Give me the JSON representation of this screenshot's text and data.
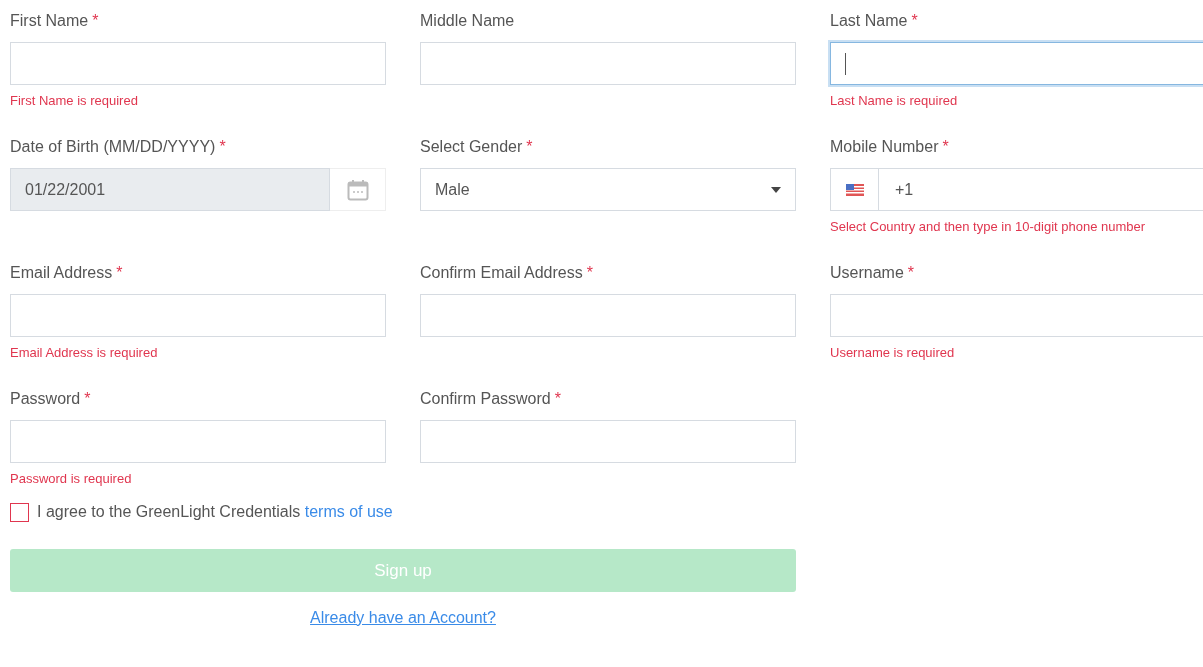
{
  "rows": [
    {
      "fields": [
        {
          "kind": "text",
          "label": "First Name",
          "required_mark": "*",
          "focused": false,
          "error": "First Name is required"
        },
        {
          "kind": "text",
          "label": "Middle Name",
          "focused": false
        },
        {
          "kind": "text",
          "label": "Last Name",
          "required_mark": "*",
          "focused": true,
          "error": "Last Name is required"
        }
      ]
    },
    {
      "fields": [
        {
          "kind": "date",
          "label": "Date of Birth (MM/DD/YYYY)",
          "required_mark": "*",
          "focused": false,
          "value": "01/22/2001"
        },
        {
          "kind": "select",
          "label": "Select Gender",
          "required_mark": "*",
          "focused": false,
          "value": "Male"
        },
        {
          "kind": "phone",
          "label": "Mobile Number",
          "required_mark": "*",
          "focused": false,
          "value": "+1",
          "error": "Select Country and then type in 10-digit phone number"
        }
      ]
    },
    {
      "fields": [
        {
          "kind": "text",
          "label": "Email Address",
          "required_mark": "*",
          "focused": false,
          "error": "Email Address is required"
        },
        {
          "kind": "text",
          "label": "Confirm Email Address",
          "required_mark": "*",
          "focused": false
        },
        {
          "kind": "text",
          "label": "Username",
          "required_mark": "*",
          "focused": false,
          "error": "Username is required"
        }
      ]
    },
    {
      "fields": [
        {
          "kind": "password",
          "label": "Password",
          "required_mark": "*",
          "focused": false,
          "error": "Password is required"
        },
        {
          "kind": "password",
          "label": "Confirm Password",
          "required_mark": "*",
          "focused": false
        }
      ]
    }
  ],
  "agreement": {
    "checked": false,
    "invalid": true,
    "text": "I agree to the GreenLight Credentials",
    "link": "terms of use"
  },
  "submit": {
    "label": "Sign up",
    "disabled": true
  },
  "login_link": "Already have an Account?"
}
